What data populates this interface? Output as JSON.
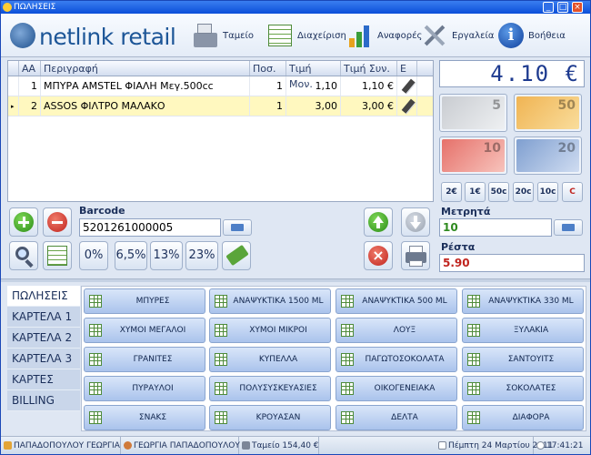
{
  "window": {
    "title": "ΠΩΛΗΣΕΙΣ"
  },
  "toolbar": {
    "logo": "netlink retail",
    "items": [
      {
        "label": "Ταμείο",
        "icon": "cash-register-icon"
      },
      {
        "label": "Διαχείριση",
        "icon": "spreadsheet-icon"
      },
      {
        "label": "Αναφορές",
        "icon": "bar-chart-icon"
      },
      {
        "label": "Εργαλεία",
        "icon": "tools-icon"
      },
      {
        "label": "Βοήθεια",
        "icon": "info-icon"
      }
    ]
  },
  "grid": {
    "headers": [
      "ΑΑ",
      "Περιγραφή",
      "Ποσ.",
      "Τιμή Μον.",
      "Τιμή Συν.",
      "Ε"
    ],
    "rows": [
      {
        "aa": "1",
        "desc": "ΜΠΥΡΑ AMSTEL ΦΙΑΛΗ Mεγ.500cc",
        "qty": "1",
        "unit": "1,10",
        "total": "1,10 €",
        "selected": false
      },
      {
        "aa": "2",
        "desc": "ASSOS ΦΙΛΤΡΟ ΜΑΛΑΚΟ",
        "qty": "1",
        "unit": "3,00",
        "total": "3,00 €",
        "selected": true
      }
    ]
  },
  "barcode": {
    "label": "Barcode",
    "value": "5201261000005"
  },
  "vat_buttons": [
    "0%",
    "6,5%",
    "13%",
    "23%"
  ],
  "payment": {
    "display": "4.10 €",
    "notes": [
      "5",
      "50",
      "10",
      "20"
    ],
    "coins": [
      "2€",
      "1€",
      "50c",
      "20c",
      "10c",
      "C"
    ],
    "cash_label": "Μετρητά",
    "cash_value": "10",
    "change_label": "Ρέστα",
    "change_value": "5.90"
  },
  "tabs": [
    "ΠΩΛΗΣΕΙΣ",
    "ΚΑΡΤΕΛΑ 1",
    "ΚΑΡΤΕΛΑ 2",
    "ΚΑΡΤΕΛΑ 3",
    "ΚΑΡΤΕΣ",
    "BILLING"
  ],
  "products": [
    [
      "ΜΠΥΡΕΣ",
      "ΑΝΑΨΥΚΤΙΚΑ 1500 ML",
      "ΑΝΑΨΥΚΤΙΚΑ 500 ML",
      "ΑΝΑΨΥΚΤΙΚΑ 330 ML"
    ],
    [
      "ΧΥΜΟΙ ΜΕΓΑΛΟΙ",
      "ΧΥΜΟΙ ΜΙΚΡΟΙ",
      "ΛΟΥΞ",
      "ΞΥΛΑΚΙΑ"
    ],
    [
      "ΓΡΑΝΙΤΕΣ",
      "ΚΥΠΕΛΛΑ",
      "ΠΑΓΩΤΟΣΟΚΟΛΑΤΑ",
      "ΣΑΝΤΟΥΙΤΣ"
    ],
    [
      "ΠΥΡΑΥΛΟΙ",
      "ΠΟΛΥΣΥΣΚΕΥΑΣΙΕΣ",
      "ΟΙΚΟΓΕΝΕΙΑΚΑ",
      "ΣΟΚΟΛΑΤΕΣ"
    ],
    [
      "ΣΝΑΚΣ",
      "ΚΡΟΥΑΣΑΝ",
      "ΔΕΛΤΑ",
      "ΔΙΑΦΟΡΑ"
    ]
  ],
  "status": {
    "store": "ΠΑΠΑΔΟΠΟΥΛΟΥ ΓΕΩΡΓΙΑ",
    "user": "ΓΕΩΡΓΙΑ ΠΑΠΑΔΟΠΟΥΛΟΥ",
    "till": "Ταμείο 154,40 €",
    "date": "Πέμπτη 24 Μαρτίου 2011",
    "time": "17:41:21"
  },
  "colors": {
    "accent": "#1c5597",
    "selected_row": "#fff8bf",
    "change": "#c0241f",
    "cash": "#2f8a1f"
  }
}
